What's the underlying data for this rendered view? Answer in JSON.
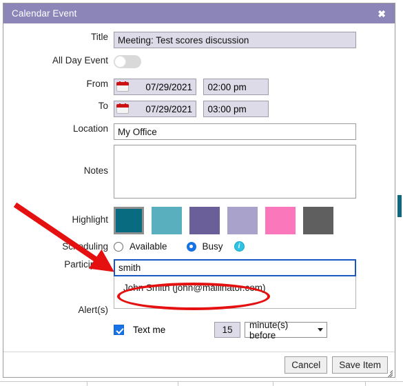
{
  "dialog": {
    "title": "Calendar Event",
    "close_icon": "close-icon"
  },
  "form": {
    "title_label": "Title",
    "title_value": "Meeting: Test scores discussion",
    "all_day_label": "All Day Event",
    "all_day_state": "off",
    "from_label": "From",
    "from_date": "07/29/2021",
    "from_time": "02:00 pm",
    "to_label": "To",
    "to_date": "07/29/2021",
    "to_time": "03:00 pm",
    "location_label": "Location",
    "location_value": "My Office",
    "notes_label": "Notes",
    "notes_value": "",
    "highlight_label": "Highlight",
    "scheduling_label": "Scheduling",
    "scheduling_available": "Available",
    "scheduling_busy": "Busy",
    "scheduling_selected": "Busy",
    "info_icon": "info-icon",
    "participant_label": "Participant",
    "participant_value": "smith",
    "participant_suggestion": "John Smith (john@mailinator.com)",
    "alerts_label": "Alert(s)",
    "alert_checkbox_label": "Text me",
    "alert_checked": true,
    "alert_amount": "15",
    "alert_unit": "minute(s) before"
  },
  "highlight_swatches": [
    {
      "name": "teal-dark",
      "color": "#096b80",
      "selected": true
    },
    {
      "name": "teal-light",
      "color": "#5aafbe",
      "selected": false
    },
    {
      "name": "purple",
      "color": "#6a5f98",
      "selected": false
    },
    {
      "name": "lavender",
      "color": "#a9a3cc",
      "selected": false
    },
    {
      "name": "pink",
      "color": "#fa77bb",
      "selected": false
    },
    {
      "name": "gray",
      "color": "#5f5f5f",
      "selected": false
    }
  ],
  "footer": {
    "cancel_label": "Cancel",
    "save_label": "Save Item"
  },
  "colors": {
    "titlebar": "#8b85b8",
    "field_fill": "#dedbe8",
    "focus_border": "#1a56c4",
    "annotation": "#e51010",
    "accent_blue": "#1673e6",
    "background_accent": "#0b6a7d"
  }
}
